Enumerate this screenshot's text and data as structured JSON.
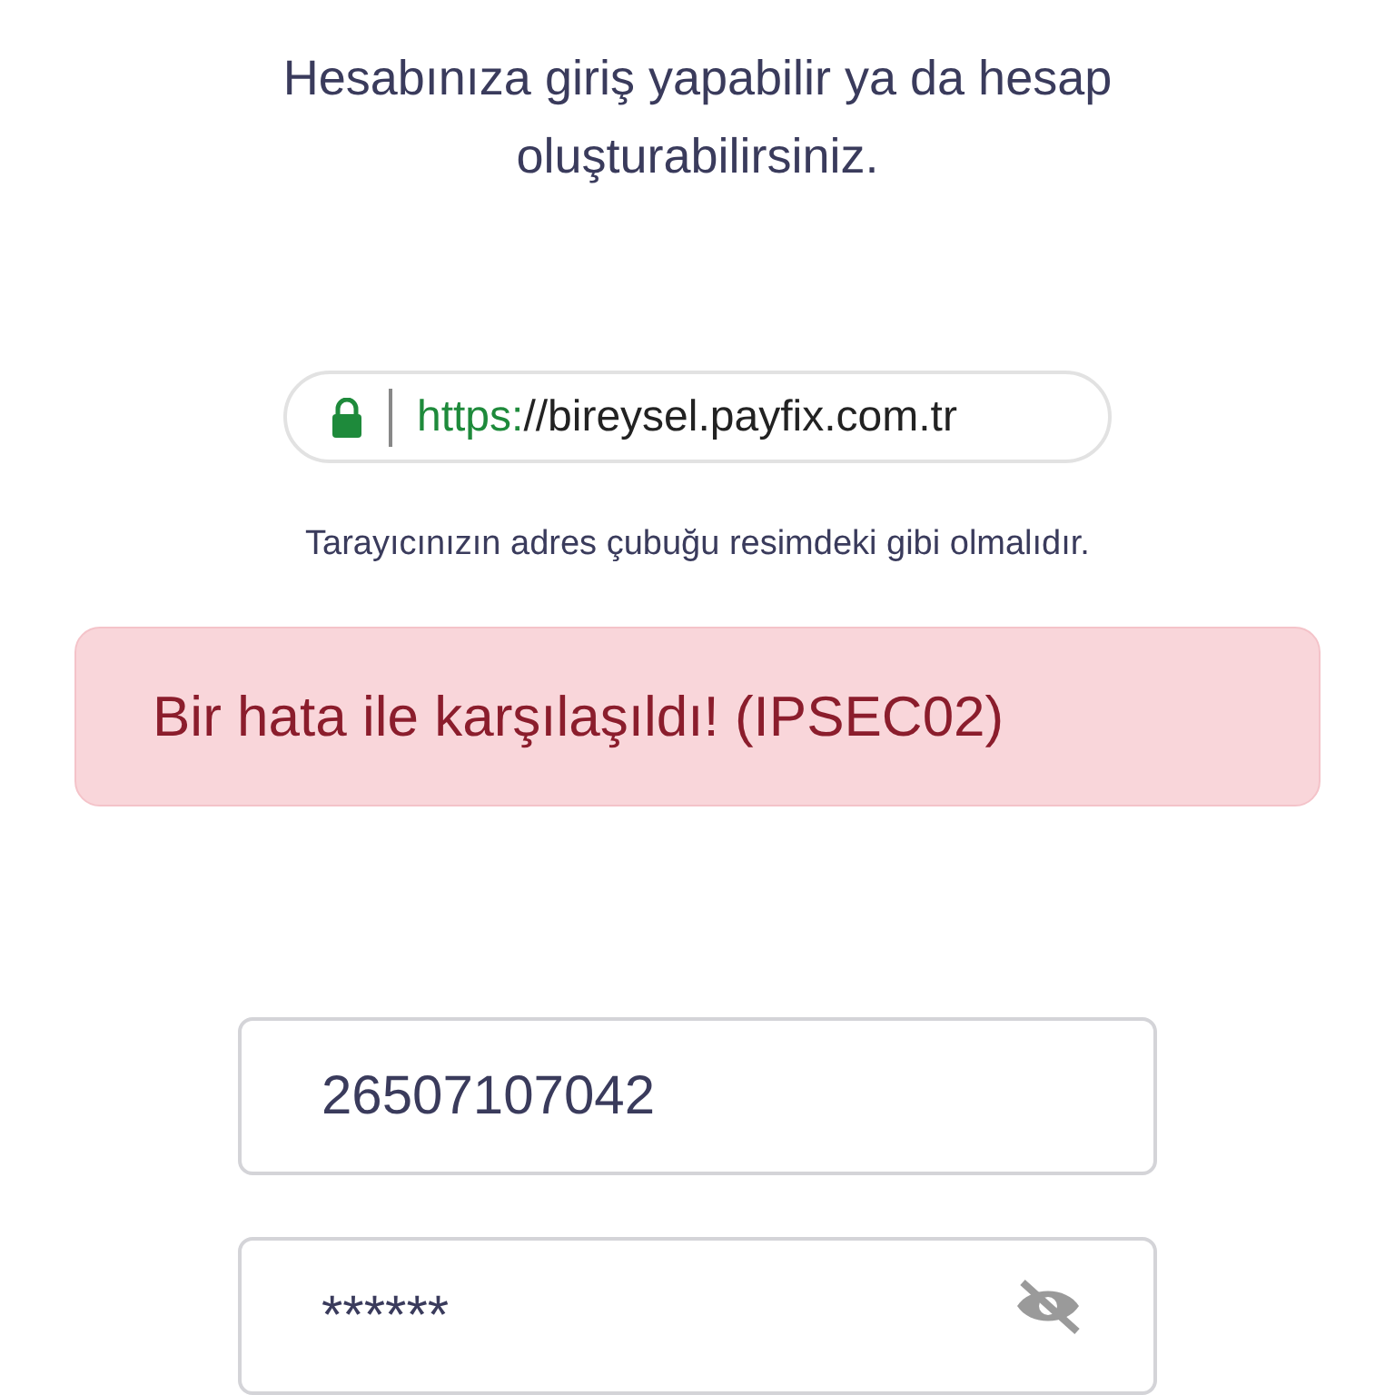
{
  "intro": "Hesabınıza giriş yapabilir ya da hesap oluşturabilirsiniz.",
  "address_bar": {
    "secure": true,
    "scheme": "https:",
    "rest": "//bireysel.payfix.com.tr"
  },
  "hint": "Tarayıcınızın adres çubuğu resimdeki gibi olmalıdır.",
  "alert": {
    "kind": "error",
    "message": "Bir hata ile karşılaşıldı! (IPSEC02)"
  },
  "fields": [
    {
      "kind": "text",
      "value": "26507107042"
    },
    {
      "kind": "password",
      "value": "******",
      "visible": false
    }
  ]
}
